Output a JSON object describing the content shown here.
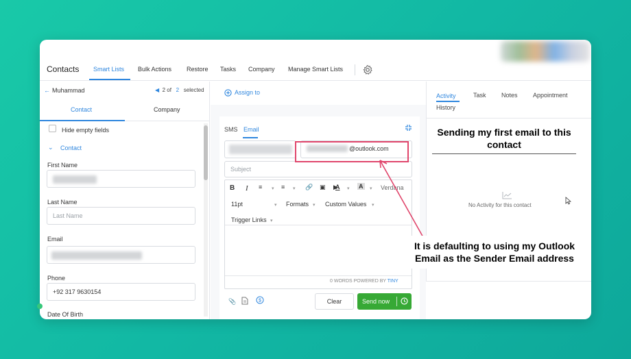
{
  "nav": {
    "title": "Contacts",
    "tabs": [
      "Smart Lists",
      "Bulk Actions",
      "Restore",
      "Tasks",
      "Company",
      "Manage Smart Lists"
    ]
  },
  "left": {
    "contact_name": "Muhammad",
    "pager": {
      "current": "2",
      "of_label": "of",
      "total": "2",
      "selected_label": "selected"
    },
    "tabs": [
      "Contact",
      "Company"
    ],
    "hide_empty_label": "Hide empty fields",
    "section_label": "Contact",
    "fields": {
      "first_name_label": "First Name",
      "last_name_label": "Last Name",
      "last_name_placeholder": "Last Name",
      "email_label": "Email",
      "phone_label": "Phone",
      "phone_value": "+92 317 9630154",
      "dob_label": "Date Of Birth"
    }
  },
  "middle": {
    "assign_label": "Assign to",
    "tabs": [
      "SMS",
      "Email"
    ],
    "from_email_suffix": "@outlook.com",
    "subject_placeholder": "Subject",
    "toolbar": {
      "font": "Verdana",
      "size": "11pt",
      "formats": "Formats",
      "custom_values": "Custom Values",
      "trigger_links": "Trigger Links"
    },
    "word_count": "0 WORDS POWERED BY",
    "word_count_brand": "TINY",
    "clear_label": "Clear",
    "send_label": "Send now"
  },
  "right": {
    "tabs": [
      "Activity",
      "Task",
      "Notes",
      "Appointment",
      "History"
    ],
    "empty_label": "No Activity for this contact"
  },
  "annotations": {
    "top": "Sending my first email to this contact",
    "bottom": "It is defaulting to using my Outlook Email as the Sender Email address"
  },
  "colors": {
    "accent": "#2e86de",
    "send_button": "#37a935",
    "highlight": "#e0456b"
  }
}
